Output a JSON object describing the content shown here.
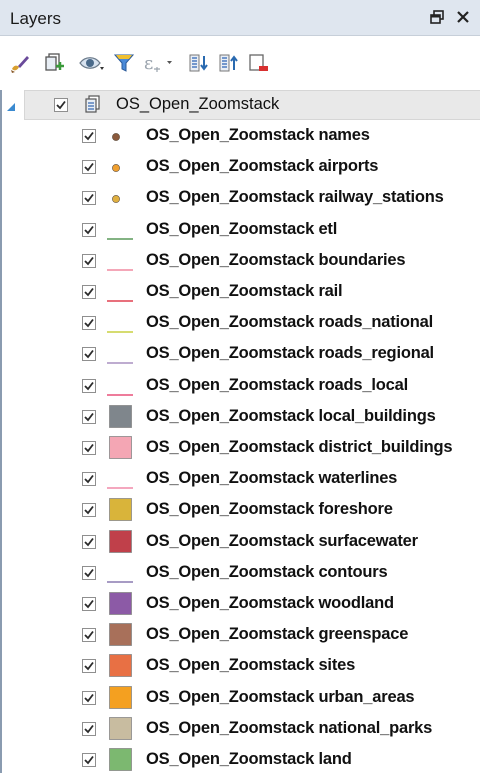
{
  "panel": {
    "title": "Layers",
    "float_icon": "undock-icon",
    "close_icon": "close-icon"
  },
  "toolbar": {
    "tools": [
      {
        "name": "open-layer-styling-icon"
      },
      {
        "name": "add-group-icon"
      },
      {
        "name": "manage-map-themes-icon"
      },
      {
        "name": "filter-legend-icon"
      },
      {
        "name": "filter-by-expression-icon"
      },
      {
        "name": "expand-all-icon"
      },
      {
        "name": "collapse-all-icon"
      },
      {
        "name": "remove-layer-icon"
      }
    ]
  },
  "group": {
    "label": "OS_Open_Zoomstack",
    "checked": true,
    "expanded": true
  },
  "layers": [
    {
      "label": "OS_Open_Zoomstack names",
      "symbol": "point",
      "color": "#8b5a3c",
      "checked": true
    },
    {
      "label": "OS_Open_Zoomstack airports",
      "symbol": "point",
      "color": "#f0a030",
      "checked": true
    },
    {
      "label": "OS_Open_Zoomstack railway_stations",
      "symbol": "point",
      "color": "#e0b040",
      "checked": true
    },
    {
      "label": "OS_Open_Zoomstack etl",
      "symbol": "line",
      "color": "#5a9a5a",
      "checked": true
    },
    {
      "label": "OS_Open_Zoomstack boundaries",
      "symbol": "line",
      "color": "#f08aa0",
      "checked": true
    },
    {
      "label": "OS_Open_Zoomstack rail",
      "symbol": "line",
      "color": "#e04050",
      "checked": true
    },
    {
      "label": "OS_Open_Zoomstack roads_national",
      "symbol": "line",
      "color": "#c8d040",
      "checked": true
    },
    {
      "label": "OS_Open_Zoomstack roads_regional",
      "symbol": "line",
      "color": "#a890c0",
      "checked": true
    },
    {
      "label": "OS_Open_Zoomstack roads_local",
      "symbol": "line",
      "color": "#e8507a",
      "checked": true
    },
    {
      "label": "OS_Open_Zoomstack local_buildings",
      "symbol": "fill",
      "color": "#7f868c",
      "checked": true
    },
    {
      "label": "OS_Open_Zoomstack district_buildings",
      "symbol": "fill",
      "color": "#f4a6b4",
      "checked": true
    },
    {
      "label": "OS_Open_Zoomstack waterlines",
      "symbol": "line",
      "color": "#f08aa8",
      "checked": true
    },
    {
      "label": "OS_Open_Zoomstack foreshore",
      "symbol": "fill",
      "color": "#d9b43a",
      "checked": true
    },
    {
      "label": "OS_Open_Zoomstack surfacewater",
      "symbol": "fill",
      "color": "#c0404a",
      "checked": true
    },
    {
      "label": "OS_Open_Zoomstack contours",
      "symbol": "line",
      "color": "#8a7ab0",
      "checked": true
    },
    {
      "label": "OS_Open_Zoomstack woodland",
      "symbol": "fill",
      "color": "#8c5aa6",
      "checked": true
    },
    {
      "label": "OS_Open_Zoomstack greenspace",
      "symbol": "fill",
      "color": "#a8705a",
      "checked": true
    },
    {
      "label": "OS_Open_Zoomstack sites",
      "symbol": "fill",
      "color": "#e87044",
      "checked": true
    },
    {
      "label": "OS_Open_Zoomstack urban_areas",
      "symbol": "fill",
      "color": "#f4a020",
      "checked": true
    },
    {
      "label": "OS_Open_Zoomstack national_parks",
      "symbol": "fill",
      "color": "#c8bca0",
      "checked": true
    },
    {
      "label": "OS_Open_Zoomstack land",
      "symbol": "fill",
      "color": "#7cb870",
      "checked": true
    }
  ]
}
